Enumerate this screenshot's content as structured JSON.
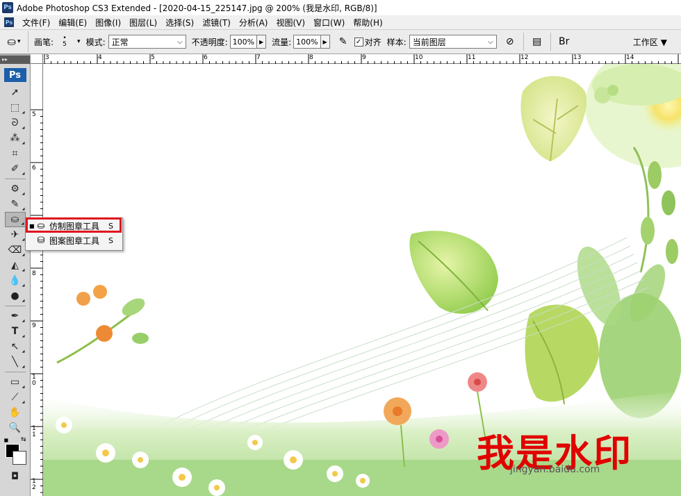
{
  "window": {
    "title": "Adobe Photoshop CS3 Extended - [2020-04-15_225147.jpg @ 200% (我是水印, RGB/8)]",
    "app_icon": "Ps"
  },
  "menubar": {
    "icon": "Ps",
    "items": [
      "文件(F)",
      "编辑(E)",
      "图像(I)",
      "图层(L)",
      "选择(S)",
      "滤镜(T)",
      "分析(A)",
      "视图(V)",
      "窗口(W)",
      "帮助(H)"
    ]
  },
  "options": {
    "brush_label": "画笔:",
    "brush_size": "5",
    "mode_label": "模式:",
    "mode_value": "正常",
    "opacity_label": "不透明度:",
    "opacity_value": "100%",
    "flow_label": "流量:",
    "flow_value": "100%",
    "aligned_label": "对齐",
    "aligned_checked": true,
    "sample_label": "样本:",
    "sample_value": "当前图层",
    "workspace_label": "工作区"
  },
  "toolbox": {
    "header": "▸▸",
    "logo": "Ps",
    "tools": [
      "move-tool",
      "marquee-tool",
      "lasso-tool",
      "magic-wand-tool",
      "crop-tool",
      "slice-tool",
      "healing-brush-tool",
      "brush-tool",
      "clone-stamp-tool",
      "history-brush-tool",
      "eraser-tool",
      "paint-bucket-tool",
      "blur-tool",
      "dodge-tool",
      "pen-tool",
      "type-tool",
      "path-selection-tool",
      "line-tool",
      "notes-tool",
      "eyedropper-tool",
      "hand-tool",
      "zoom-tool"
    ]
  },
  "rulers": {
    "top": [
      "3",
      "4",
      "5",
      "6",
      "7",
      "8",
      "9",
      "10",
      "11",
      "12",
      "13",
      "14"
    ],
    "left": [
      "5",
      "6",
      "7",
      "8",
      "9",
      "1\n0",
      "1\n1",
      "1\n2"
    ]
  },
  "flyout": {
    "items": [
      {
        "label": "仿制图章工具",
        "key": "S",
        "selected": true
      },
      {
        "label": "图案图章工具",
        "key": "S",
        "selected": false
      }
    ]
  },
  "canvas": {
    "watermark_text": "我是水印",
    "baidu_text": "jingyan.baidu.com"
  },
  "colors": {
    "highlight": "#e0141e",
    "watermark": "#e00000",
    "foreground": "#000000",
    "background": "#ffffff"
  }
}
